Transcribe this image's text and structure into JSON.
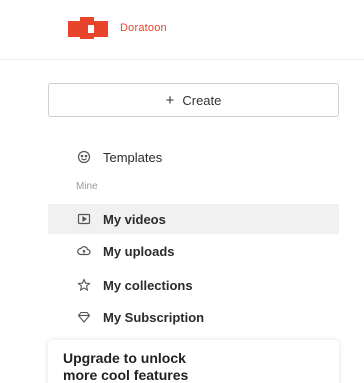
{
  "brand": {
    "name": "Doratoon",
    "color": "#e8442b",
    "logo_icon": "doratoon-logo-icon"
  },
  "create": {
    "icon": "plus-icon",
    "plus": "+",
    "label": "Create"
  },
  "nav": {
    "templates": {
      "label": "Templates",
      "icon": "templates-icon"
    },
    "section_label": "Mine",
    "items": [
      {
        "label": "My videos",
        "icon": "video-icon",
        "active": true
      },
      {
        "label": "My uploads",
        "icon": "cloud-upload-icon",
        "active": false
      },
      {
        "label": "My collections",
        "icon": "star-icon",
        "active": false
      },
      {
        "label": "My Subscription",
        "icon": "diamond-icon",
        "active": false
      }
    ]
  },
  "upgrade": {
    "line1": "Upgrade to unlock",
    "line2": "more cool features"
  }
}
